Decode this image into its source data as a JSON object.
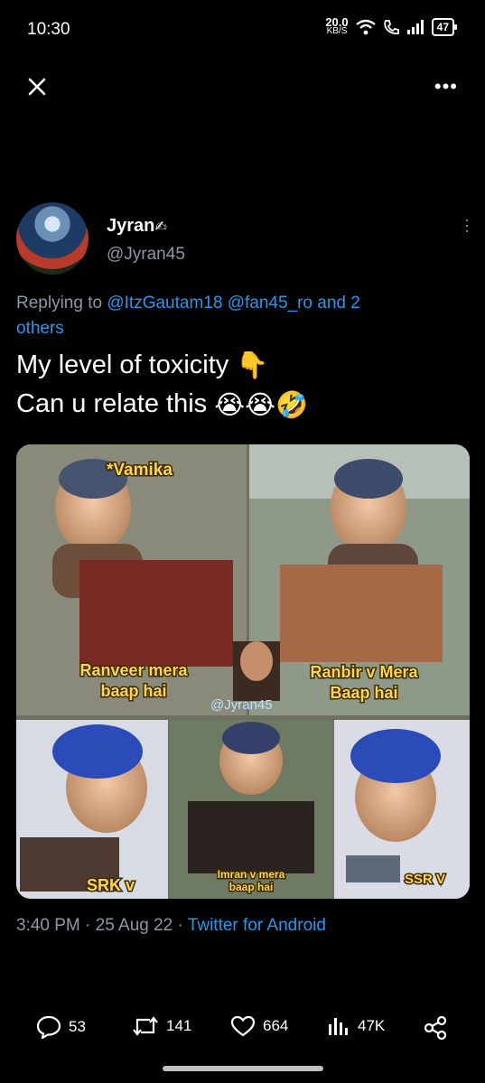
{
  "status_bar": {
    "time": "10:30",
    "net_speed_value": "20.0",
    "net_speed_unit": "KB/S",
    "battery": "47",
    "icons": [
      "wifi-icon",
      "call-icon",
      "signal-icon",
      "battery-icon"
    ]
  },
  "top_bar": {
    "close_icon": "close-icon",
    "more_icon": "more-icon"
  },
  "tweet": {
    "author_name": "Jyran",
    "author_name_emoji": "✍",
    "author_handle": "@Jyran45",
    "replying_prefix": "Replying to",
    "replying_mention_1": "@ItzGautam18",
    "replying_mention_2": "@fan45_ro",
    "replying_suffix_and": "and 2",
    "replying_others": "others",
    "text_line_1": "My level of toxicity",
    "text_line_1_emoji": "👇",
    "text_line_2": "Can u relate this",
    "text_line_2_emoji": "😭😭🤣",
    "media": {
      "captions": {
        "top_left": "*Vamika",
        "middle_left": "Ranveer mera baap hai",
        "middle_right": "Ranbir v Mera Baap hai",
        "watermark": "@Jyran45",
        "bottom_left": "SRK v",
        "bottom_center": "Imran v mera baap hai",
        "bottom_right": "SSR V"
      }
    },
    "timestamp_time": "3:40 PM",
    "timestamp_date": "25 Aug 22",
    "source": "Twitter for Android",
    "stats": {
      "replies": "53",
      "retweets": "141",
      "likes": "664",
      "views": "47K"
    }
  },
  "colors": {
    "background": "#000000",
    "link": "#1d9bf0",
    "muted": "#8b98a5",
    "caption": "#ffd54a"
  }
}
